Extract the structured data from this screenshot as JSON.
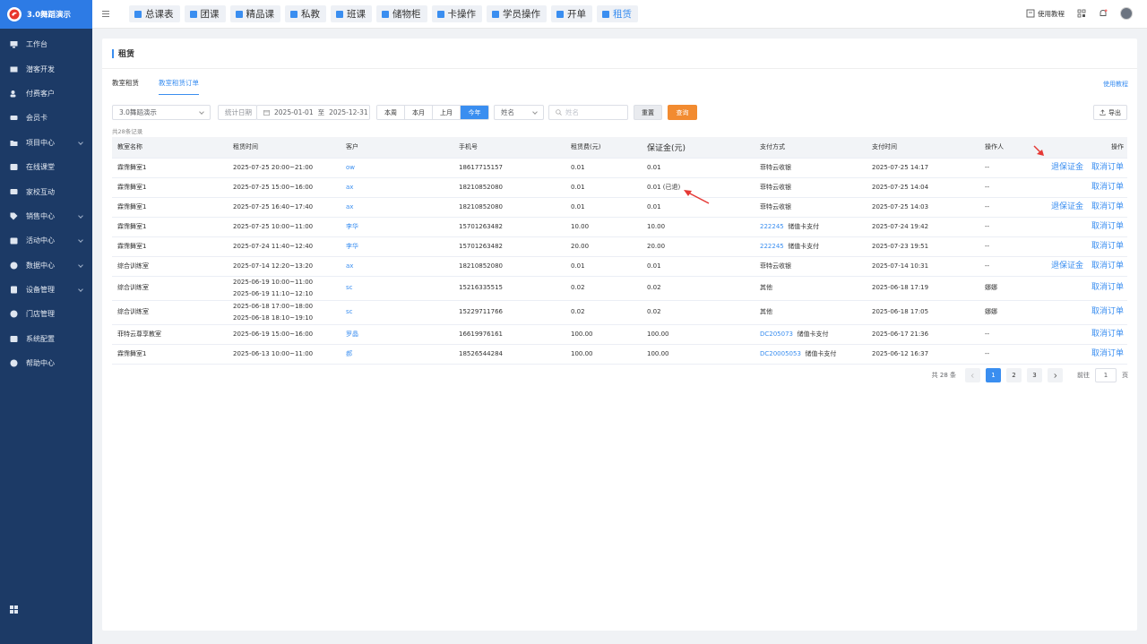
{
  "sidebar": {
    "brand": "3.0舞蹈演示",
    "items": [
      {
        "label": "工作台",
        "icon": "desktop-icon",
        "expand": false
      },
      {
        "label": "潜客开发",
        "icon": "id-card-icon",
        "expand": false
      },
      {
        "label": "付费客户",
        "icon": "users-icon",
        "expand": false
      },
      {
        "label": "会员卡",
        "icon": "card-icon",
        "expand": false
      },
      {
        "label": "项目中心",
        "icon": "folder-icon",
        "expand": true
      },
      {
        "label": "在线课堂",
        "icon": "classroom-icon",
        "expand": false
      },
      {
        "label": "家校互动",
        "icon": "chat-icon",
        "expand": false
      },
      {
        "label": "销售中心",
        "icon": "tag-icon",
        "expand": true
      },
      {
        "label": "活动中心",
        "icon": "calendar-icon",
        "expand": true
      },
      {
        "label": "数据中心",
        "icon": "chart-pie-icon",
        "expand": true
      },
      {
        "label": "设备管理",
        "icon": "device-icon",
        "expand": true
      },
      {
        "label": "门店管理",
        "icon": "store-icon",
        "expand": false
      },
      {
        "label": "系统配置",
        "icon": "gear-icon",
        "expand": false
      },
      {
        "label": "帮助中心",
        "icon": "help-icon",
        "expand": false
      }
    ]
  },
  "header": {
    "tabs": [
      "总课表",
      "团课",
      "精品课",
      "私教",
      "班课",
      "储物柜",
      "卡操作",
      "学员操作",
      "开单",
      "租赁"
    ],
    "active_tab": 9,
    "help": "使用教程"
  },
  "page": {
    "title": "租赁",
    "tabs": [
      "教室租赁",
      "教室租赁订单"
    ],
    "active_tab": 1,
    "help": "使用教程"
  },
  "filters": {
    "store": "3.0舞蹈演示",
    "date_label": "统计日期",
    "date_start": "2025-01-01",
    "date_sep": "至",
    "date_end": "2025-12-31",
    "periods": [
      "本周",
      "本月",
      "上月",
      "今年"
    ],
    "active_period": 3,
    "field_select": "姓名",
    "search_placeholder": "姓名",
    "reset": "重置",
    "query": "查询",
    "export": "导出"
  },
  "records": "共28条记录",
  "table": {
    "columns": [
      "教室名称",
      "租赁时间",
      "客户",
      "手机号",
      "租赁费(元)",
      "保证金(元)",
      "支付方式",
      "支付时间",
      "操作人",
      "操作"
    ],
    "rows": [
      {
        "room": "霖霈舞室1",
        "times": [
          "2025-07-25 20:00~21:00"
        ],
        "customer": "ow",
        "phone": "18617715157",
        "fee": "0.01",
        "deposit": "0.01",
        "pay_code": "",
        "pay": "菲特云收银",
        "pay_time": "2025-07-25 14:17",
        "operator": "--",
        "refund": "退保证金",
        "cancel": "取消订单"
      },
      {
        "room": "霖霈舞室1",
        "times": [
          "2025-07-25 15:00~16:00"
        ],
        "customer": "ax",
        "phone": "18210852080",
        "fee": "0.01",
        "deposit": "0.01 (已退)",
        "pay_code": "",
        "pay": "菲特云收银",
        "pay_time": "2025-07-25 14:04",
        "operator": "--",
        "refund": "",
        "cancel": "取消订单"
      },
      {
        "room": "霖霈舞室1",
        "times": [
          "2025-07-25 16:40~17:40"
        ],
        "customer": "ax",
        "phone": "18210852080",
        "fee": "0.01",
        "deposit": "0.01",
        "pay_code": "",
        "pay": "菲特云收银",
        "pay_time": "2025-07-25 14:03",
        "operator": "--",
        "refund": "退保证金",
        "cancel": "取消订单"
      },
      {
        "room": "霖霈舞室1",
        "times": [
          "2025-07-25 10:00~11:00"
        ],
        "customer": "李华",
        "phone": "15701263482",
        "fee": "10.00",
        "deposit": "10.00",
        "pay_code": "222245",
        "pay": "储值卡支付",
        "pay_time": "2025-07-24 19:42",
        "operator": "--",
        "refund": "",
        "cancel": "取消订单"
      },
      {
        "room": "霖霈舞室1",
        "times": [
          "2025-07-24 11:40~12:40"
        ],
        "customer": "李华",
        "phone": "15701263482",
        "fee": "20.00",
        "deposit": "20.00",
        "pay_code": "222245",
        "pay": "储值卡支付",
        "pay_time": "2025-07-23 19:51",
        "operator": "--",
        "refund": "",
        "cancel": "取消订单"
      },
      {
        "room": "综合训练室",
        "times": [
          "2025-07-14 12:20~13:20"
        ],
        "customer": "ax",
        "phone": "18210852080",
        "fee": "0.01",
        "deposit": "0.01",
        "pay_code": "",
        "pay": "菲特云收银",
        "pay_time": "2025-07-14 10:31",
        "operator": "--",
        "refund": "退保证金",
        "cancel": "取消订单"
      },
      {
        "room": "综合训练室",
        "times": [
          "2025-06-19 10:00~11:00",
          "2025-06-19 11:10~12:10"
        ],
        "customer": "sc",
        "phone": "15216335515",
        "fee": "0.02",
        "deposit": "0.02",
        "pay_code": "",
        "pay": "其他",
        "pay_time": "2025-06-18 17:19",
        "operator": "娜娜",
        "refund": "",
        "cancel": "取消订单"
      },
      {
        "room": "综合训练室",
        "times": [
          "2025-06-18 17:00~18:00",
          "2025-06-18 18:10~19:10"
        ],
        "customer": "sc",
        "phone": "15229711766",
        "fee": "0.02",
        "deposit": "0.02",
        "pay_code": "",
        "pay": "其他",
        "pay_time": "2025-06-18 17:05",
        "operator": "娜娜",
        "refund": "",
        "cancel": "取消订单"
      },
      {
        "room": "菲特云尊享教室",
        "times": [
          "2025-06-19 15:00~16:00"
        ],
        "customer": "罗晶",
        "phone": "16619976161",
        "fee": "100.00",
        "deposit": "100.00",
        "pay_code": "DC205073",
        "pay": "储值卡支付",
        "pay_time": "2025-06-17 21:36",
        "operator": "--",
        "refund": "",
        "cancel": "取消订单"
      },
      {
        "room": "霖霈舞室1",
        "times": [
          "2025-06-13 10:00~11:00"
        ],
        "customer": "郝",
        "phone": "18526544284",
        "fee": "100.00",
        "deposit": "100.00",
        "pay_code": "DC20005053",
        "pay": "储值卡支付",
        "pay_time": "2025-06-12 16:37",
        "operator": "--",
        "refund": "",
        "cancel": "取消订单"
      }
    ]
  },
  "pagination": {
    "total": "共 28 条",
    "pages": [
      "1",
      "2",
      "3"
    ],
    "current": 0,
    "goto_label": "前往",
    "goto_value": "1",
    "page_unit": "页"
  },
  "colors": {
    "primary": "#3a8ef0",
    "sidebar": "#1c3a66",
    "query": "#f28b30",
    "arrow": "#e53935"
  }
}
